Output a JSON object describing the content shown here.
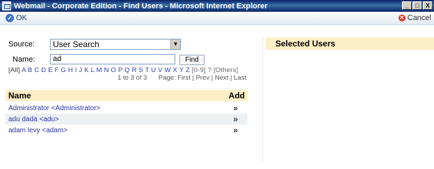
{
  "window": {
    "title": "Webmail - Corporate Edition - Find Users - Microsoft Internet Explorer",
    "buttons": [
      "_",
      "□",
      "X"
    ]
  },
  "toolbar": {
    "ok_label": "OK",
    "cancel_label": "Cancel"
  },
  "form": {
    "source_label": "Source:",
    "source_value": "User Search",
    "name_label": "Name:",
    "name_value": "ad",
    "find_label": "Find"
  },
  "alpha_nav": {
    "all": "[All]",
    "letters": "A B C D E F G H I J K L M N O P Q R S T U V W X Y Z",
    "rest": "[0-9] ? [Others]"
  },
  "paging": {
    "count": "1 to 3 of 3",
    "label": "Page: First | Prev | Next | Last"
  },
  "table": {
    "col_name": "Name",
    "col_add": "Add",
    "rows": [
      {
        "user": "Administrator <Administrator>",
        "add": "»"
      },
      {
        "user": "adu dada <adu>",
        "add": "»"
      },
      {
        "user": "adam levy <adam>",
        "add": "»"
      }
    ]
  },
  "selected": {
    "header": "Selected Users"
  },
  "colors": {
    "titlebar": "#0a246a",
    "header_bg": "#fcefc6",
    "link": "#2a34a5"
  }
}
